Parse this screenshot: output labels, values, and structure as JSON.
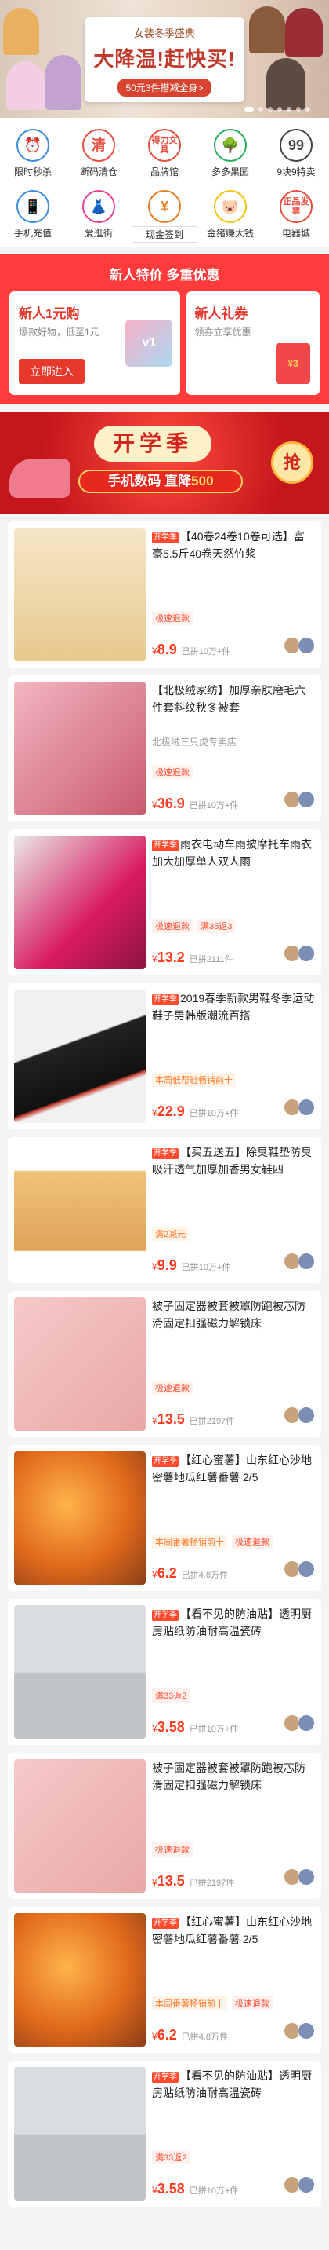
{
  "banner": {
    "subtitle": "女装冬季盛典",
    "title": "大降温!赶快买!",
    "tag": "50元3件搭减全身>"
  },
  "grid": [
    {
      "label": "限时秒杀",
      "icon": "alarm-clock-icon",
      "glyph": "⏰",
      "color": "#3c8dde"
    },
    {
      "label": "断码清仓",
      "icon": "clear-stock-icon",
      "glyph": "清",
      "color": "#e74c3c"
    },
    {
      "label": "品牌馆",
      "icon": "brand-icon",
      "glyph": "得力文具",
      "color": "#e74c3c"
    },
    {
      "label": "多多果园",
      "icon": "tree-icon",
      "glyph": "🌳",
      "color": "#27ae60"
    },
    {
      "label": "9块9特卖",
      "icon": "nine-nine-icon",
      "glyph": "99",
      "color": "#444"
    },
    {
      "label": "手机充值",
      "icon": "phone-icon",
      "glyph": "📱",
      "color": "#3c8dde"
    },
    {
      "label": "爱逛街",
      "icon": "dress-icon",
      "glyph": "👗",
      "color": "#e84393"
    },
    {
      "label": "现金签到",
      "icon": "cash-icon",
      "glyph": "¥",
      "color": "#e67e22"
    },
    {
      "label": "金猪赚大钱",
      "icon": "pig-icon",
      "glyph": "🐷",
      "color": "#f1c40f"
    },
    {
      "label": "电器城",
      "icon": "appliance-icon",
      "glyph": "正品发票",
      "color": "#e74c3c"
    }
  ],
  "promo": {
    "title": "新人特价 多重优惠",
    "left": {
      "name": "新人1元购",
      "desc": "爆款好物，低至1元",
      "button": "立即进入"
    },
    "right": {
      "name": "新人礼券",
      "desc": "领券立享优惠"
    },
    "vol_label": "v1",
    "redpack_label": "¥3"
  },
  "school": {
    "title": "开学季",
    "sub_prefix": "手机数码 直降",
    "sub_amount": "500",
    "grab": "抢"
  },
  "items": [
    {
      "badge": "开学季",
      "title": "【40卷24卷10卷可选】富豪5.5斤40卷天然竹浆",
      "shop": "",
      "tags": [
        "极速退款"
      ],
      "tag_styles": [
        "red"
      ],
      "price": "8.9",
      "sold": "已拼10万+件",
      "thumb": "tissue"
    },
    {
      "badge": "",
      "title": "【北极绒家纺】加厚亲肤磨毛六件套斜纹秋冬被套",
      "shop": "北极绒三只虎专卖店",
      "tags": [
        "极速退款"
      ],
      "tag_styles": [
        "red"
      ],
      "price": "36.9",
      "sold": "已拼10万+件",
      "thumb": "bedding"
    },
    {
      "badge": "开学季",
      "title": "雨衣电动车雨披摩托车雨衣加大加厚单人双人雨",
      "shop": "",
      "tags": [
        "极速退款",
        "满35返3"
      ],
      "tag_styles": [
        "red",
        "red"
      ],
      "price": "13.2",
      "sold": "已拼2111件",
      "thumb": "raincoat"
    },
    {
      "badge": "开学季",
      "title": "2019春季新款男鞋冬季运动鞋子男韩版潮流百搭",
      "shop": "",
      "tags": [
        "本周低帮鞋畅销前十"
      ],
      "tag_styles": [
        "orange"
      ],
      "price": "22.9",
      "sold": "已拼10万+件",
      "thumb": "shoe"
    },
    {
      "badge": "开学季",
      "title": "【买五送五】除臭鞋垫防臭吸汗透气加厚加香男女鞋四",
      "shop": "",
      "tags": [
        "满2减元"
      ],
      "tag_styles": [
        "orange"
      ],
      "price": "9.9",
      "sold": "已拼10万+件",
      "thumb": "insole"
    },
    {
      "badge": "",
      "title": "被子固定器被套被罩防跑被芯防滑固定扣强磁力解锁床",
      "shop": "",
      "tags": [
        "极速退款"
      ],
      "tag_styles": [
        "red"
      ],
      "price": "13.5",
      "sold": "已拼2197件",
      "thumb": "pink"
    },
    {
      "badge": "开学季",
      "title": "【红心蜜薯】山东红心沙地密薯地瓜红薯番薯 2/5",
      "shop": "",
      "tags": [
        "本周番薯畅销前十",
        "极速退款"
      ],
      "tag_styles": [
        "orange",
        "red"
      ],
      "price": "6.2",
      "sold": "已拼4.8万件",
      "thumb": "potato"
    },
    {
      "badge": "开学季",
      "title": "【看不见的防油贴】透明厨房贴纸防油耐高温瓷砖",
      "shop": "",
      "tags": [
        "满33返2"
      ],
      "tag_styles": [
        "red"
      ],
      "price": "3.58",
      "sold": "已拼10万+件",
      "thumb": "kitchen"
    },
    {
      "badge": "",
      "title": "被子固定器被套被罩防跑被芯防滑固定扣强磁力解锁床",
      "shop": "",
      "tags": [
        "极速退款"
      ],
      "tag_styles": [
        "red"
      ],
      "price": "13.5",
      "sold": "已拼2197件",
      "thumb": "pink"
    },
    {
      "badge": "开学季",
      "title": "【红心蜜薯】山东红心沙地密薯地瓜红薯番薯 2/5",
      "shop": "",
      "tags": [
        "本周番薯畅销前十",
        "极速退款"
      ],
      "tag_styles": [
        "orange",
        "red"
      ],
      "price": "6.2",
      "sold": "已拼4.8万件",
      "thumb": "potato"
    },
    {
      "badge": "开学季",
      "title": "【看不见的防油贴】透明厨房贴纸防油耐高温瓷砖",
      "shop": "",
      "tags": [
        "满33返2"
      ],
      "tag_styles": [
        "red"
      ],
      "price": "3.58",
      "sold": "已拼10万+件",
      "thumb": "kitchen"
    }
  ],
  "currency": "¥"
}
